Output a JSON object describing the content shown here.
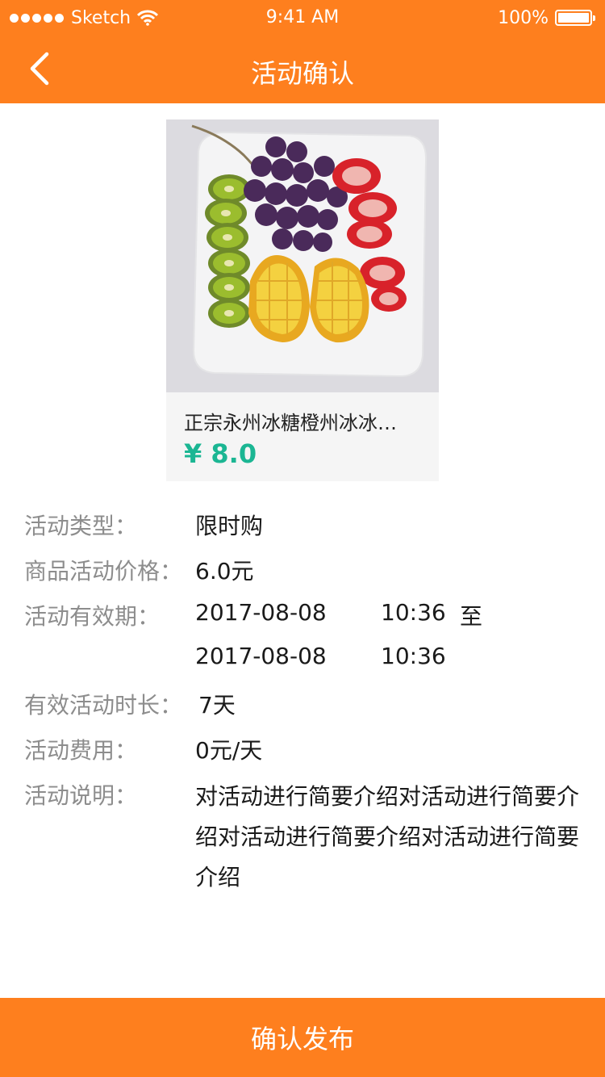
{
  "status_bar": {
    "carrier": "Sketch",
    "time": "9:41 AM",
    "battery": "100%",
    "battery_level": 1.0
  },
  "nav": {
    "title": "活动确认",
    "back_icon": "chevron-left-icon"
  },
  "product": {
    "name": "正宗永州冰糖橙州冰冰…",
    "price": "¥ 8.0",
    "price_color": "#1bb693"
  },
  "info": {
    "type_label": "活动类型：",
    "type_value": "限时购",
    "price_label": "商品活动价格：",
    "price_value": "6.0元",
    "period_label": "活动有效期：",
    "start_date": "2017-08-08",
    "start_time": "10:36",
    "to_label": "至",
    "end_date": "2017-08-08",
    "end_time": "10:36",
    "duration_label": "有效活动时长：",
    "duration_value": "7天",
    "fee_label": "活动费用：",
    "fee_value": "0元/天",
    "desc_label": "活动说明：",
    "desc_value": "对活动进行简要介绍对活动进行简要介绍对活动进行简要介绍对活动进行简要介绍"
  },
  "footer": {
    "confirm_label": "确认发布"
  },
  "colors": {
    "accent": "#fe7f1e",
    "label_gray": "#8d8d8d"
  }
}
